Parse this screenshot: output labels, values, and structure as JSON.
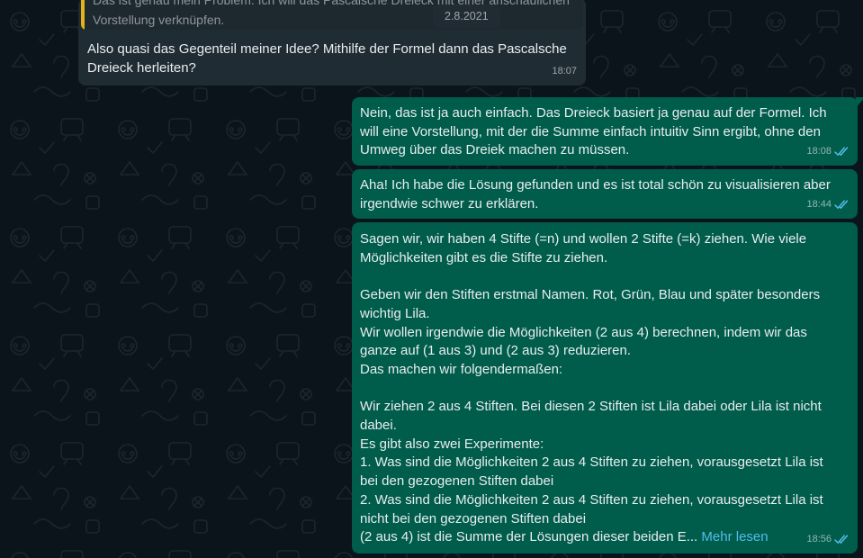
{
  "date_chip": "2.8.2021",
  "messages": [
    {
      "quoted_text": "Das ist genau mein Problem. Ich will das Pascalsche Dreieck mit einer anschaulichen\nVorstellung verknüpfen.",
      "text": "Also quasi das Gegenteil meiner Idee? Mithilfe der Formel dann das Pascalsche\nDreieck herleiten?",
      "time": "18:07"
    },
    {
      "text": "Nein, das ist ja auch einfach. Das Dreieck basiert ja genau auf der Formel. Ich\nwill eine Vorstellung, mit der die Summe einfach intuitiv Sinn ergibt, ohne den\nUmweg über das Dreiek machen zu müssen.",
      "time": "18:08"
    },
    {
      "text": "Aha! Ich habe die Lösung gefunden und es ist total schön zu visualisieren aber\nirgendwie schwer zu erklären.",
      "time": "18:44"
    },
    {
      "text": "Sagen wir, wir haben 4 Stifte (=n) und wollen 2 Stifte (=k) ziehen. Wie viele\nMöglichkeiten gibt es die Stifte zu ziehen.\n\nGeben wir den Stiften erstmal Namen. Rot, Grün, Blau und später besonders\nwichtig Lila.\nWir wollen irgendwie die Möglichkeiten (2 aus 4) berechnen, indem wir das\nganze auf (1 aus 3) und (2 aus 3) reduzieren.\nDas machen wir folgendermaßen:\n\nWir ziehen 2 aus 4 Stiften. Bei diesen 2 Stiften ist Lila dabei oder Lila ist nicht\ndabei.\nEs gibt also zwei Experimente:\n1. Was sind die Möglichkeiten 2 aus 4 Stiften zu ziehen, vorausgesetzt Lila ist\nbei den gezogenen Stiften dabei\n2. Was sind die Möglichkeiten 2 aus 4 Stiften zu ziehen, vorausgesetzt Lila ist\nnicht bei den gezogenen Stiften dabei\n(2 aus 4) ist die Summe der Lösungen dieser beiden E...",
      "read_more": "Mehr lesen",
      "time": "18:56"
    }
  ],
  "colors": {
    "background": "#0b141a",
    "incoming_bubble": "#202c33",
    "outgoing_bubble": "#005c4b",
    "read_ticks": "#53bdeb",
    "quote_bar": "#e5b11d"
  },
  "icons": {
    "read_receipt": "double-check-icon"
  }
}
